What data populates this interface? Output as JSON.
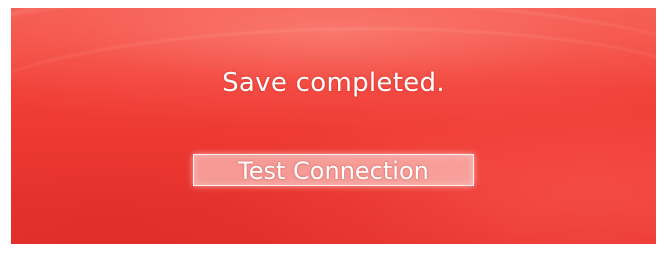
{
  "dialog": {
    "message": "Save completed.",
    "button_label": "Test Connection"
  },
  "colors": {
    "background": "#f03a32",
    "text": "#ffffff"
  }
}
